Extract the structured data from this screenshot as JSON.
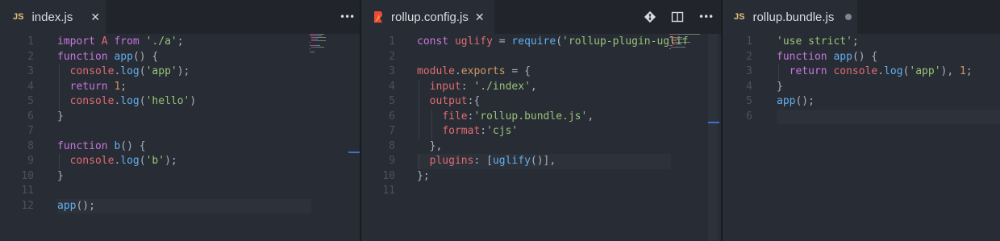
{
  "panes": [
    {
      "id": "p1",
      "tab": {
        "icon": "js-icon",
        "icon_text": "JS",
        "label": "index.js",
        "close": "✕",
        "modified": false
      },
      "toolbar": {
        "more": "•••"
      },
      "highlight_line": 12,
      "lines": [
        {
          "n": "1",
          "tokens": [
            {
              "t": "import ",
              "c": "kw"
            },
            {
              "t": "A",
              "c": "id"
            },
            {
              "t": " from ",
              "c": "kw"
            },
            {
              "t": "'./a'",
              "c": "str"
            },
            {
              "t": ";",
              "c": "txt"
            }
          ]
        },
        {
          "n": "2",
          "tokens": [
            {
              "t": "function ",
              "c": "kw"
            },
            {
              "t": "app",
              "c": "fn"
            },
            {
              "t": "() {",
              "c": "txt"
            }
          ]
        },
        {
          "n": "3",
          "tokens": [
            {
              "t": "  ",
              "c": "txt"
            },
            {
              "t": "console",
              "c": "id"
            },
            {
              "t": ".",
              "c": "txt"
            },
            {
              "t": "log",
              "c": "fn"
            },
            {
              "t": "(",
              "c": "txt"
            },
            {
              "t": "'app'",
              "c": "str"
            },
            {
              "t": ");",
              "c": "txt"
            }
          ]
        },
        {
          "n": "4",
          "tokens": [
            {
              "t": "  ",
              "c": "txt"
            },
            {
              "t": "return ",
              "c": "kw"
            },
            {
              "t": "1",
              "c": "num"
            },
            {
              "t": ";",
              "c": "txt"
            }
          ]
        },
        {
          "n": "5",
          "tokens": [
            {
              "t": "  ",
              "c": "txt"
            },
            {
              "t": "console",
              "c": "id"
            },
            {
              "t": ".",
              "c": "txt"
            },
            {
              "t": "log",
              "c": "fn"
            },
            {
              "t": "(",
              "c": "txt"
            },
            {
              "t": "'hello'",
              "c": "str"
            },
            {
              "t": ")",
              "c": "txt"
            }
          ]
        },
        {
          "n": "6",
          "tokens": [
            {
              "t": "}",
              "c": "txt"
            }
          ]
        },
        {
          "n": "7",
          "tokens": []
        },
        {
          "n": "8",
          "tokens": [
            {
              "t": "function ",
              "c": "kw"
            },
            {
              "t": "b",
              "c": "fn"
            },
            {
              "t": "() {",
              "c": "txt"
            }
          ]
        },
        {
          "n": "9",
          "tokens": [
            {
              "t": "  ",
              "c": "txt"
            },
            {
              "t": "console",
              "c": "id"
            },
            {
              "t": ".",
              "c": "txt"
            },
            {
              "t": "log",
              "c": "fn"
            },
            {
              "t": "(",
              "c": "txt"
            },
            {
              "t": "'b'",
              "c": "str"
            },
            {
              "t": ");",
              "c": "txt"
            }
          ]
        },
        {
          "n": "10",
          "tokens": [
            {
              "t": "}",
              "c": "txt"
            }
          ]
        },
        {
          "n": "11",
          "tokens": []
        },
        {
          "n": "12",
          "tokens": [
            {
              "t": "app",
              "c": "fn"
            },
            {
              "t": "();",
              "c": "txt"
            }
          ]
        }
      ]
    },
    {
      "id": "p2",
      "tab": {
        "icon": "rollup-icon",
        "icon_text": "",
        "label": "rollup.config.js",
        "close": "✕",
        "modified": false
      },
      "toolbar": {
        "git": "git-compare-icon",
        "split": "split-editor-icon",
        "more": "•••"
      },
      "highlight_line": 9,
      "lines": [
        {
          "n": "1",
          "tokens": [
            {
              "t": "const ",
              "c": "kw"
            },
            {
              "t": "uglify",
              "c": "id"
            },
            {
              "t": " = ",
              "c": "txt"
            },
            {
              "t": "require",
              "c": "fn"
            },
            {
              "t": "(",
              "c": "txt"
            },
            {
              "t": "'rollup-plugin-uglif",
              "c": "str"
            }
          ]
        },
        {
          "n": "2",
          "tokens": []
        },
        {
          "n": "3",
          "tokens": [
            {
              "t": "module",
              "c": "id"
            },
            {
              "t": ".",
              "c": "txt"
            },
            {
              "t": "exports",
              "c": "prop"
            },
            {
              "t": " = {",
              "c": "txt"
            }
          ]
        },
        {
          "n": "4",
          "tokens": [
            {
              "t": "  ",
              "c": "txt"
            },
            {
              "t": "input",
              "c": "id"
            },
            {
              "t": ": ",
              "c": "txt"
            },
            {
              "t": "'./index'",
              "c": "str"
            },
            {
              "t": ",",
              "c": "txt"
            }
          ]
        },
        {
          "n": "5",
          "tokens": [
            {
              "t": "  ",
              "c": "txt"
            },
            {
              "t": "output",
              "c": "id"
            },
            {
              "t": ":{",
              "c": "txt"
            }
          ]
        },
        {
          "n": "6",
          "tokens": [
            {
              "t": "    ",
              "c": "txt"
            },
            {
              "t": "file",
              "c": "id"
            },
            {
              "t": ":",
              "c": "txt"
            },
            {
              "t": "'rollup.bundle.js'",
              "c": "str"
            },
            {
              "t": ",",
              "c": "txt"
            }
          ]
        },
        {
          "n": "7",
          "tokens": [
            {
              "t": "    ",
              "c": "txt"
            },
            {
              "t": "format",
              "c": "id"
            },
            {
              "t": ":",
              "c": "txt"
            },
            {
              "t": "'cjs'",
              "c": "str"
            }
          ]
        },
        {
          "n": "8",
          "tokens": [
            {
              "t": "  },",
              "c": "txt"
            }
          ]
        },
        {
          "n": "9",
          "tokens": [
            {
              "t": "  ",
              "c": "txt"
            },
            {
              "t": "plugins",
              "c": "id"
            },
            {
              "t": ": [",
              "c": "txt"
            },
            {
              "t": "uglify",
              "c": "fn"
            },
            {
              "t": "()],",
              "c": "txt"
            }
          ]
        },
        {
          "n": "10",
          "tokens": [
            {
              "t": "};",
              "c": "txt"
            }
          ]
        },
        {
          "n": "11",
          "tokens": []
        }
      ]
    },
    {
      "id": "p3",
      "tab": {
        "icon": "js-icon",
        "icon_text": "JS",
        "label": "rollup.bundle.js",
        "close": "",
        "modified": true
      },
      "toolbar": {},
      "highlight_line": 6,
      "lines": [
        {
          "n": "1",
          "tokens": [
            {
              "t": "'use strict'",
              "c": "str"
            },
            {
              "t": ";",
              "c": "txt"
            }
          ]
        },
        {
          "n": "2",
          "tokens": [
            {
              "t": "function ",
              "c": "kw"
            },
            {
              "t": "app",
              "c": "fn"
            },
            {
              "t": "() {",
              "c": "txt"
            }
          ]
        },
        {
          "n": "3",
          "tokens": [
            {
              "t": "  ",
              "c": "txt"
            },
            {
              "t": "return ",
              "c": "kw"
            },
            {
              "t": "console",
              "c": "id"
            },
            {
              "t": ".",
              "c": "txt"
            },
            {
              "t": "log",
              "c": "fn"
            },
            {
              "t": "(",
              "c": "txt"
            },
            {
              "t": "'app'",
              "c": "str"
            },
            {
              "t": "), ",
              "c": "txt"
            },
            {
              "t": "1",
              "c": "num"
            },
            {
              "t": ";",
              "c": "txt"
            }
          ]
        },
        {
          "n": "4",
          "tokens": [
            {
              "t": "}",
              "c": "txt"
            }
          ]
        },
        {
          "n": "5",
          "tokens": [
            {
              "t": "app",
              "c": "fn"
            },
            {
              "t": "();",
              "c": "txt"
            }
          ]
        },
        {
          "n": "6",
          "tokens": []
        }
      ]
    }
  ]
}
